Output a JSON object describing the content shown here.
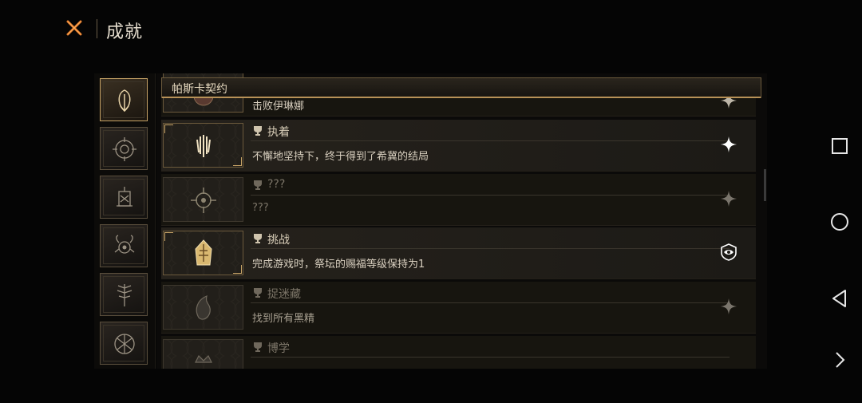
{
  "header": {
    "title": "成就",
    "close_icon": "close-icon"
  },
  "categories": [
    {
      "icon": "pasca-pact-icon",
      "active": true
    },
    {
      "icon": "eye-sigil-icon",
      "active": false
    },
    {
      "icon": "lantern-sigil-icon",
      "active": false
    },
    {
      "icon": "horned-eye-icon",
      "active": false
    },
    {
      "icon": "feather-tree-icon",
      "active": false
    },
    {
      "icon": "rune-circle-icon",
      "active": false
    }
  ],
  "section": {
    "title": "帕斯卡契约"
  },
  "achievements": [
    {
      "name": "",
      "desc": "击败伊琳娜",
      "unlocked": true,
      "partial": true
    },
    {
      "name": "执着",
      "desc": "不懈地坚持下，终于得到了希冀的结局",
      "unlocked": true,
      "status_icon": "sparkle-icon"
    },
    {
      "name": "???",
      "desc": "???",
      "unlocked": false,
      "status_icon": "sparkle-icon"
    },
    {
      "name": "挑战",
      "desc": "完成游戏时，祭坛的赐福等级保持为1",
      "unlocked": true,
      "status_icon": "shield-eye-icon"
    },
    {
      "name": "捉迷藏",
      "desc": "找到所有黑精",
      "unlocked": false,
      "status_icon": "sparkle-icon"
    },
    {
      "name": "博学",
      "desc": "",
      "unlocked": false,
      "partial": true
    }
  ],
  "colors": {
    "gold": "#c9a567",
    "background": "#050505",
    "close_accent": "#e0782a"
  },
  "system_nav": [
    "square-icon",
    "circle-icon",
    "back-triangle-icon",
    "chevron-right-icon"
  ]
}
